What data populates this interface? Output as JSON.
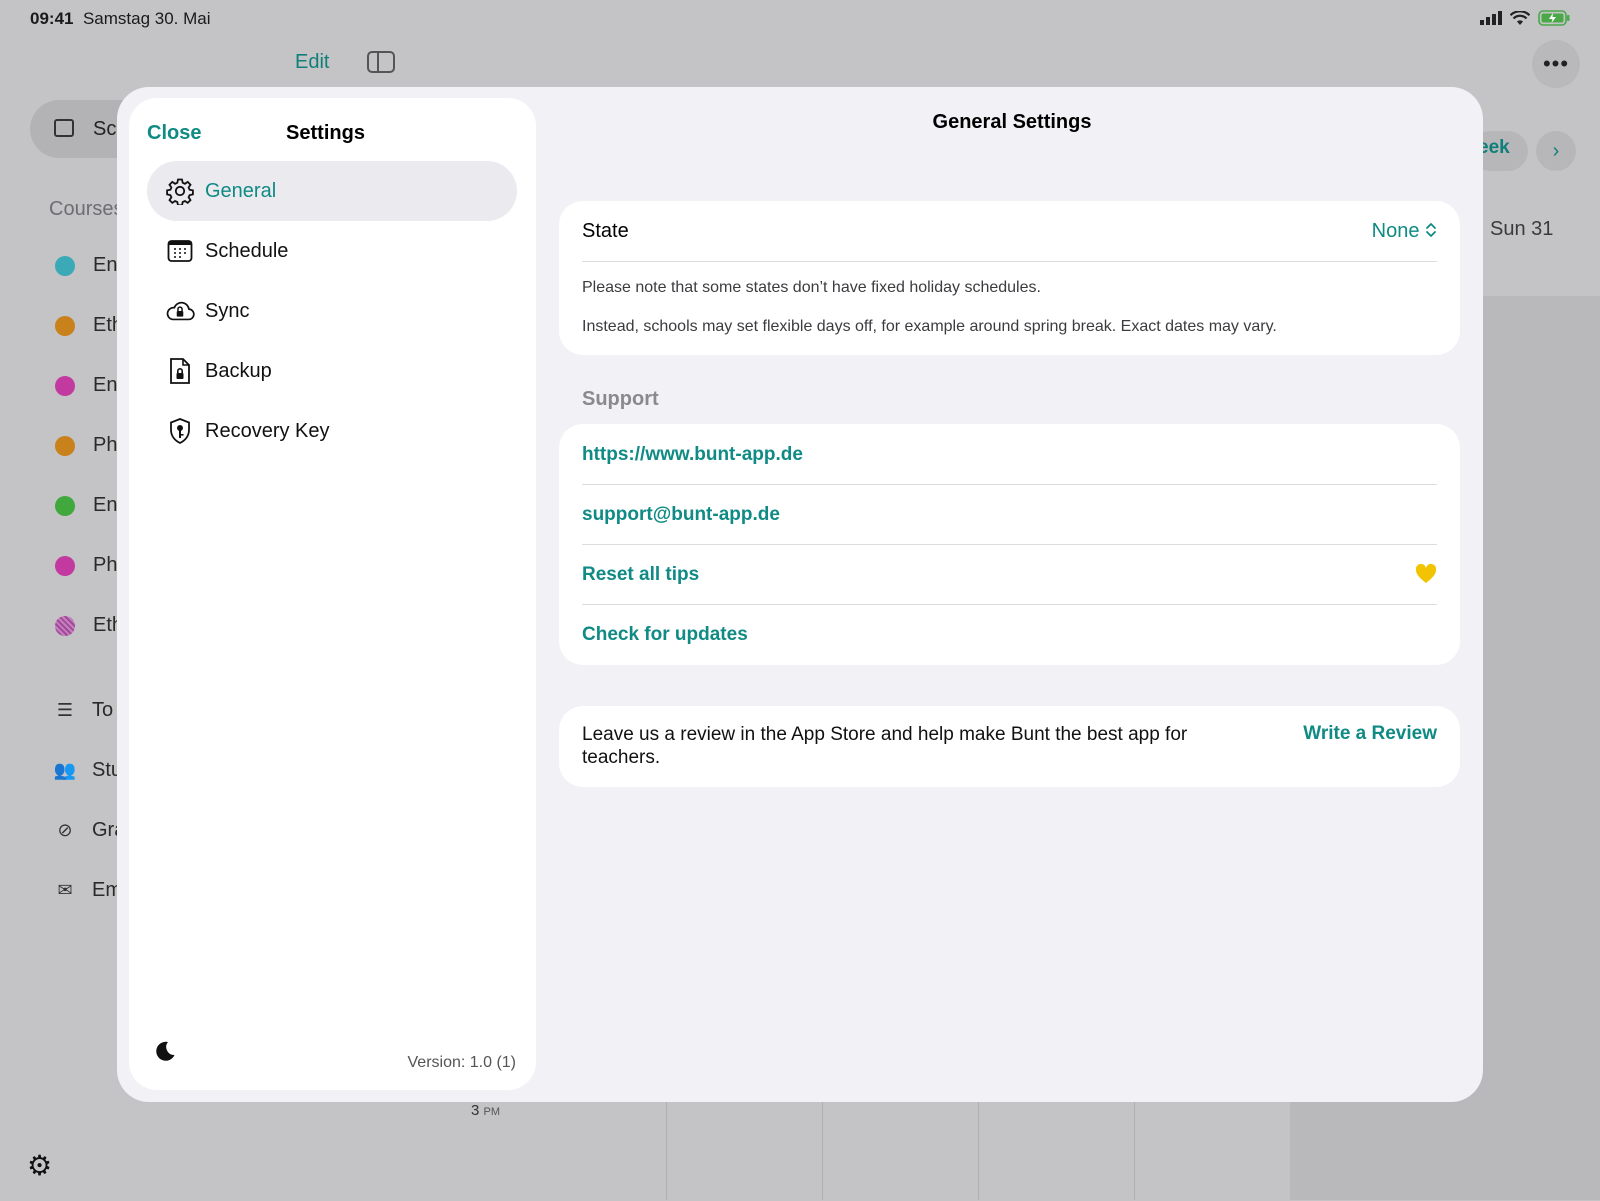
{
  "status_bar": {
    "time": "09:41",
    "date": "Samstag 30. Mai"
  },
  "background": {
    "edit_label": "Edit",
    "more_label": "•••",
    "selected_item": "Sc",
    "courses_label": "Courses",
    "courses": [
      {
        "label": "En",
        "color": "#3ba9b6"
      },
      {
        "label": "Eth",
        "color": "#c9811b"
      },
      {
        "label": "En",
        "color": "#c23a9f"
      },
      {
        "label": "Ph",
        "color": "#c9811b"
      },
      {
        "label": "En",
        "color": "#41a83e"
      },
      {
        "label": "Ph",
        "color": "#c23a9f"
      },
      {
        "label": "Eth",
        "color": "#a04a9a"
      }
    ],
    "nav": [
      {
        "label": "To",
        "icon": "checklist-icon"
      },
      {
        "label": "Stu",
        "icon": "people-icon"
      },
      {
        "label": "Gra",
        "icon": "grade-icon"
      },
      {
        "label": "Em",
        "icon": "envelope-icon"
      }
    ],
    "week_label": "eek",
    "next_label": "›",
    "day_label": "Sun 31",
    "time_label": "3",
    "time_suffix": "PM"
  },
  "sidebar": {
    "close_label": "Close",
    "title": "Settings",
    "items": [
      {
        "label": "General",
        "icon": "gear-icon",
        "selected": true
      },
      {
        "label": "Schedule",
        "icon": "calendar-icon",
        "selected": false
      },
      {
        "label": "Sync",
        "icon": "cloud-lock-icon",
        "selected": false
      },
      {
        "label": "Backup",
        "icon": "document-lock-icon",
        "selected": false
      },
      {
        "label": "Recovery Key",
        "icon": "shield-key-icon",
        "selected": false
      }
    ],
    "version": "Version: 1.0 (1)"
  },
  "detail": {
    "title": "General Settings",
    "state": {
      "label": "State",
      "value": "None",
      "note_1": "Please note that some states don’t have fixed holiday schedules.",
      "note_2": "Instead, schools may set flexible days off, for example around spring break. Exact dates may vary."
    },
    "support": {
      "header": "Support",
      "website": "https://www.bunt-app.de",
      "email": "support@bunt-app.de",
      "reset_tips": "Reset all tips",
      "check_updates": "Check for updates"
    },
    "review": {
      "text": "Leave us a review in the App Store and help make Bunt the best app for teachers.",
      "button": "Write a Review"
    }
  },
  "colors": {
    "accent": "#0f8a84",
    "heart": "#f2c300"
  }
}
